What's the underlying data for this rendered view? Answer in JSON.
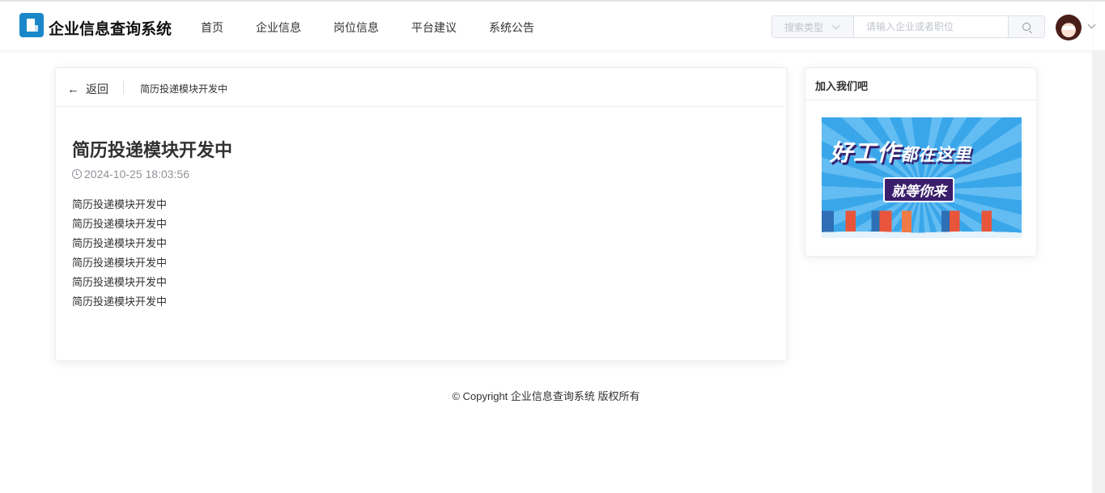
{
  "header": {
    "title": "企业信息查询系统",
    "nav": [
      "首页",
      "企业信息",
      "岗位信息",
      "平台建议",
      "系统公告"
    ],
    "search": {
      "type_placeholder": "搜索类型",
      "input_placeholder": "请输入企业或者职位"
    }
  },
  "article": {
    "back_label": "返回",
    "breadcrumb": "简历投递模块开发中",
    "title": "简历投递模块开发中",
    "time": "2024-10-25 18:03:56",
    "lines": [
      "简历投递模块开发中",
      "简历投递模块开发中",
      "简历投递模块开发中",
      "简历投递模块开发中",
      "简历投递模块开发中",
      "简历投递模块开发中"
    ]
  },
  "sidebar": {
    "title": "加入我们吧",
    "banner_line1": "好工作",
    "banner_line1b": "都在这里",
    "banner_line2": "就等你来"
  },
  "footer": "© Copyright 企业信息查询系统 版权所有"
}
